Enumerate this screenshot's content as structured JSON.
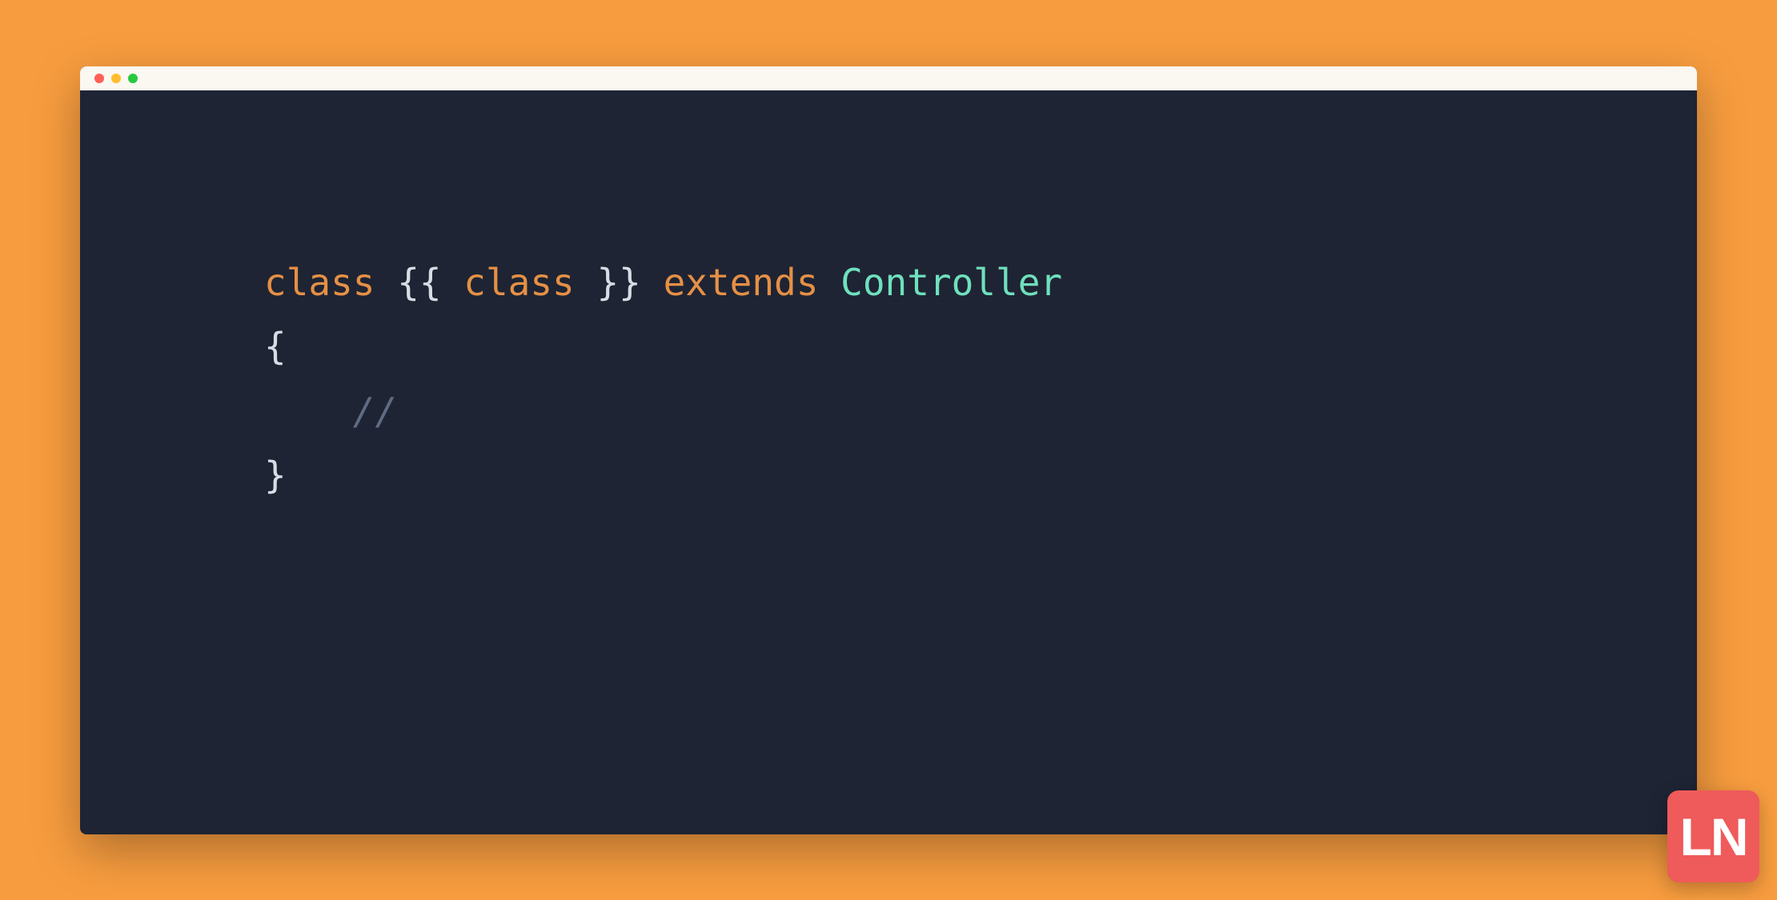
{
  "code": {
    "line1": {
      "class_kw": "class",
      "open_braces": "{{",
      "class_var": "class",
      "close_braces": "}}",
      "extends_kw": "extends",
      "classname": "Controller"
    },
    "line2": {
      "open_brace": "{"
    },
    "line3": {
      "comment": "//"
    },
    "line4": {
      "close_brace": "}"
    }
  },
  "logo": {
    "text": "LN"
  },
  "colors": {
    "background": "#f89d3f",
    "editor_bg": "#1e2433",
    "titlebar_bg": "#fbf7f1",
    "keyword": "#e59046",
    "bracket": "#d8dce5",
    "classname": "#6fe0bd",
    "comment": "#5f6b85",
    "logo_bg": "#ef5a5a"
  }
}
